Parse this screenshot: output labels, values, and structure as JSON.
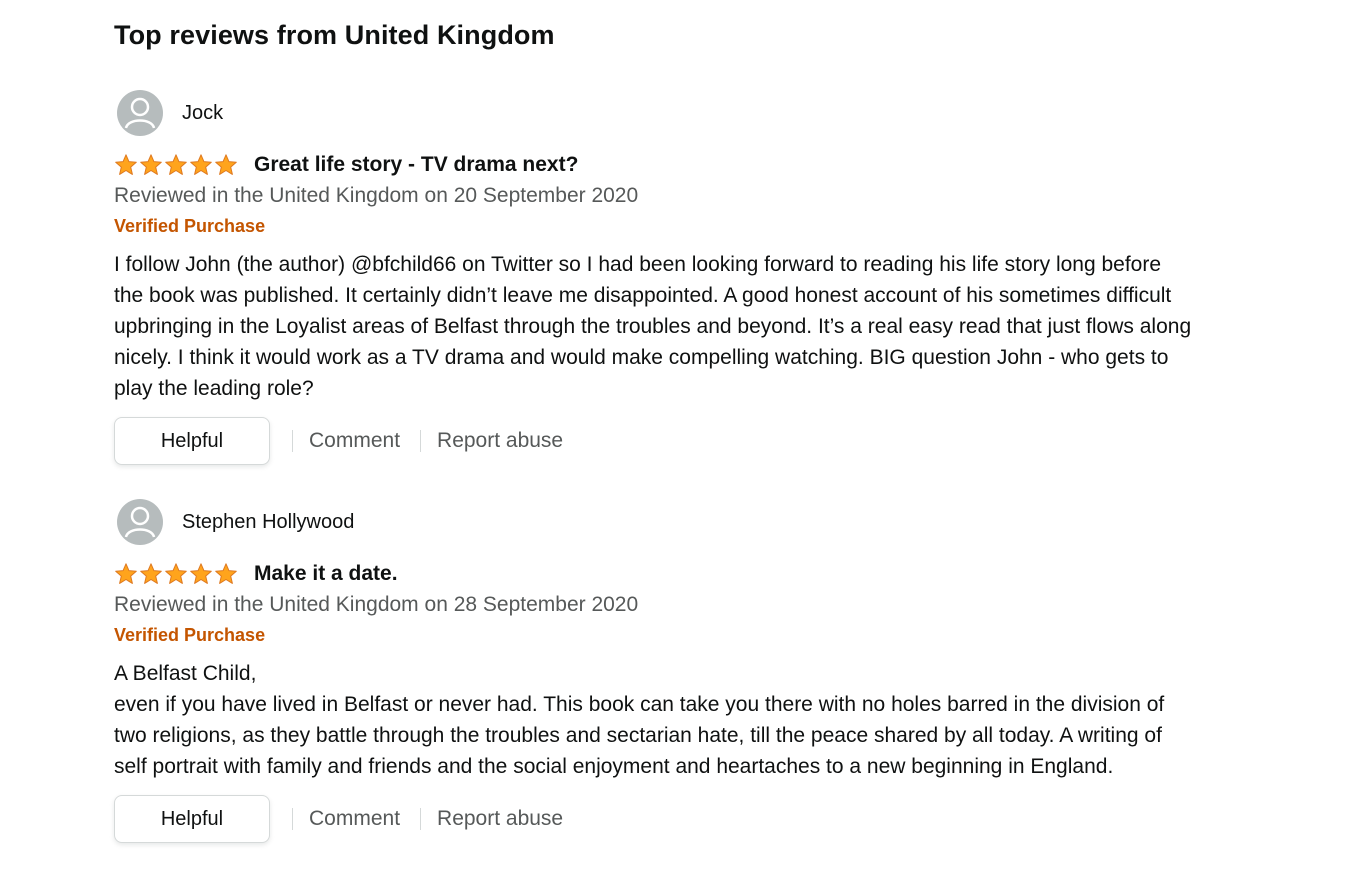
{
  "section": {
    "title": "Top reviews from United Kingdom"
  },
  "colors": {
    "star": "#ffa41c",
    "verified": "#c45500",
    "muted_text": "#565959",
    "avatar_bg": "#b6bcbd"
  },
  "reviews": [
    {
      "profile_name": "Jock",
      "rating": 5,
      "rating_max": 5,
      "title": "Great life story - TV drama next?",
      "date": "Reviewed in the United Kingdom on 20 September 2020",
      "verified": "Verified Purchase",
      "body": "I follow John (the author) @bfchild66 on Twitter so I had been looking forward to reading his life story long before the book was published. It certainly didn’t leave me disappointed. A good honest account of his sometimes difficult upbringing in the Loyalist areas of Belfast through the troubles and beyond. It’s a real easy read that just flows along nicely. I think it would work as a TV drama and would make compelling watching. BIG question John - who gets to play the leading role?",
      "helpful_label": "Helpful",
      "comment_label": "Comment",
      "report_label": "Report abuse"
    },
    {
      "profile_name": "Stephen Hollywood",
      "rating": 5,
      "rating_max": 5,
      "title": "Make it a date.",
      "date": "Reviewed in the United Kingdom on 28 September 2020",
      "verified": "Verified Purchase",
      "body": "A Belfast Child,\neven if you have lived in Belfast or never had. This book can take you there with no holes barred in the division of two religions, as they battle through the troubles and sectarian hate, till the peace shared by all today. A writing of self portrait with family and friends and the social enjoyment and heartaches to a new beginning in England.",
      "helpful_label": "Helpful",
      "comment_label": "Comment",
      "report_label": "Report abuse"
    }
  ]
}
